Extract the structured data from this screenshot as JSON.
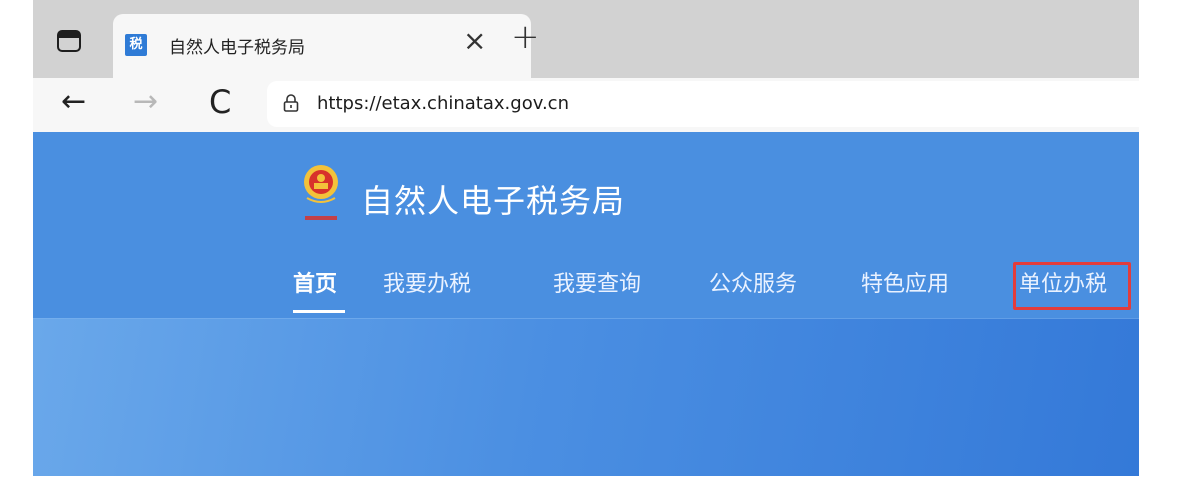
{
  "browser": {
    "tab_title": "自然人电子税务局",
    "favicon_text": "税",
    "close_glyph": "×",
    "new_tab_glyph": "+",
    "url": "https://etax.chinatax.gov.cn",
    "back_glyph": "←",
    "forward_glyph": "→",
    "reload_glyph": "C"
  },
  "site": {
    "title": "自然人电子税务局",
    "emblem_icon": "tax-emblem-icon"
  },
  "nav": {
    "items": [
      {
        "label": "首页",
        "active": true
      },
      {
        "label": "我要办税"
      },
      {
        "label": "我要查询"
      },
      {
        "label": "公众服务"
      },
      {
        "label": "特色应用"
      },
      {
        "label": "单位办税",
        "highlighted": true
      }
    ]
  },
  "colors": {
    "header": "#4a8fe0",
    "highlight": "#e23c3c"
  }
}
